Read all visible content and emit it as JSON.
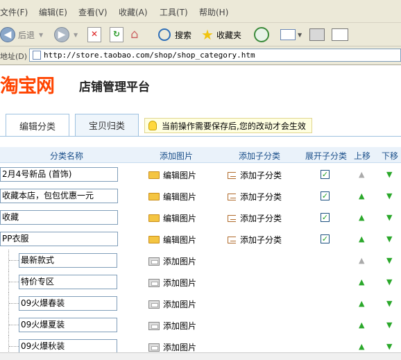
{
  "menu": [
    "文件(F)",
    "编辑(E)",
    "查看(V)",
    "收藏(A)",
    "工具(T)",
    "帮助(H)"
  ],
  "toolbar": {
    "back_label": "后退",
    "search_label": "搜索",
    "favorites_label": "收藏夹"
  },
  "address": {
    "label": "地址(D)",
    "url": "http://store.taobao.com/shop/shop_category.htm"
  },
  "header": {
    "logo": "淘宝网",
    "platform": "店铺管理平台"
  },
  "tabs": [
    {
      "label": "编辑分类",
      "active": true
    },
    {
      "label": "宝贝归类",
      "active": false
    }
  ],
  "notice": "当前操作需要保存后,您的改动才会生效",
  "columns": [
    "分类名称",
    "添加图片",
    "添加子分类",
    "展开子分类",
    "上移",
    "下移"
  ],
  "rows": [
    {
      "name": "2月4号新品 (首饰)",
      "img": "编辑图片",
      "sub": "添加子分类",
      "expanded": true,
      "up": false,
      "down": true,
      "child": false
    },
    {
      "name": "收藏本店，包包优惠一元",
      "img": "编辑图片",
      "sub": "添加子分类",
      "expanded": true,
      "up": true,
      "down": true,
      "child": false
    },
    {
      "name": "收藏",
      "img": "编辑图片",
      "sub": "添加子分类",
      "expanded": true,
      "up": true,
      "down": true,
      "child": false
    },
    {
      "name": "PP衣服",
      "img": "编辑图片",
      "sub": "添加子分类",
      "expanded": true,
      "up": true,
      "down": true,
      "child": false
    },
    {
      "name": "最新款式",
      "img": "添加图片",
      "sub": "",
      "expanded": false,
      "up": false,
      "down": true,
      "child": true
    },
    {
      "name": "特价专区",
      "img": "添加图片",
      "sub": "",
      "expanded": false,
      "up": true,
      "down": true,
      "child": true
    },
    {
      "name": "09火爆春装",
      "img": "添加图片",
      "sub": "",
      "expanded": false,
      "up": true,
      "down": true,
      "child": true
    },
    {
      "name": "09火爆夏装",
      "img": "添加图片",
      "sub": "",
      "expanded": false,
      "up": true,
      "down": true,
      "child": true
    },
    {
      "name": "09火爆秋装",
      "img": "添加图片",
      "sub": "",
      "expanded": false,
      "up": true,
      "down": true,
      "child": true
    }
  ],
  "colors": {
    "accent": "#ff4400",
    "link": "#1a4f8a",
    "arrow_active": "#2ba82b"
  }
}
